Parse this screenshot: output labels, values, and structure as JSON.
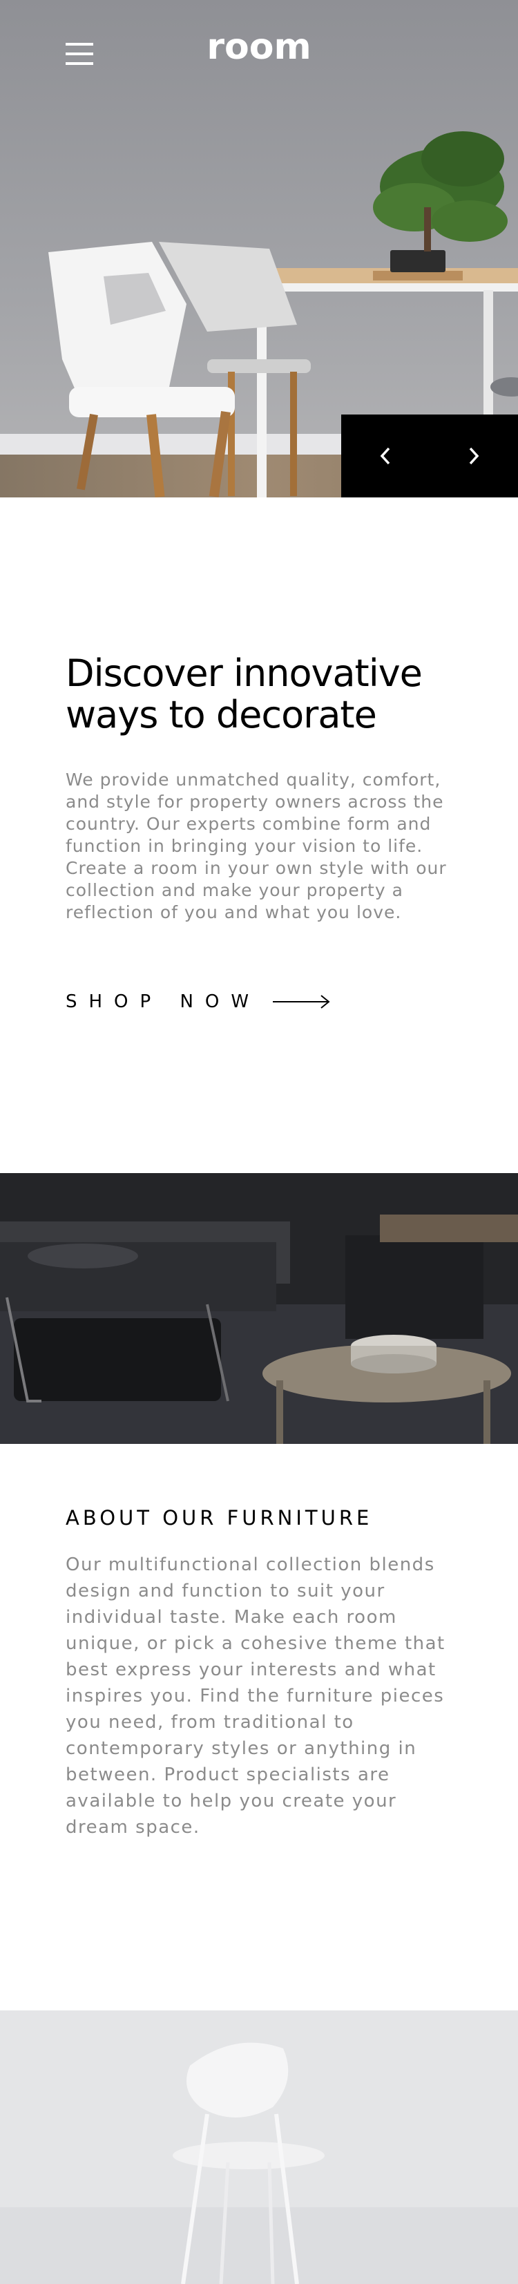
{
  "header": {
    "logo": "room",
    "menu_icon": "hamburger-icon"
  },
  "hero": {
    "prev_icon": "chevron-left-icon",
    "next_icon": "chevron-right-icon"
  },
  "intro": {
    "headline_line1": "Discover innovative",
    "headline_line2": "ways to decorate",
    "paragraph": "We provide unmatched quality, comfort, and style for property owners across the country. Our experts combine form and function in bringing your vision to life. Create a room in your own style with our collection and make your property a reflection of you and what you love.",
    "cta_label": "SHOP NOW",
    "cta_icon": "arrow-right-icon"
  },
  "about": {
    "title": "ABOUT OUR FURNITURE",
    "paragraph": "Our multifunctional collection blends design and function to suit your individual taste. Make each room unique, or pick a cohesive theme that best express your interests and what inspires you. Find the furniture pieces you need, from traditional to contemporary styles or anything in between. Product specialists are available to help you create your dream space."
  },
  "colors": {
    "text_dark": "#000000",
    "text_muted": "#8b8b8b",
    "control_bg": "#000000"
  }
}
